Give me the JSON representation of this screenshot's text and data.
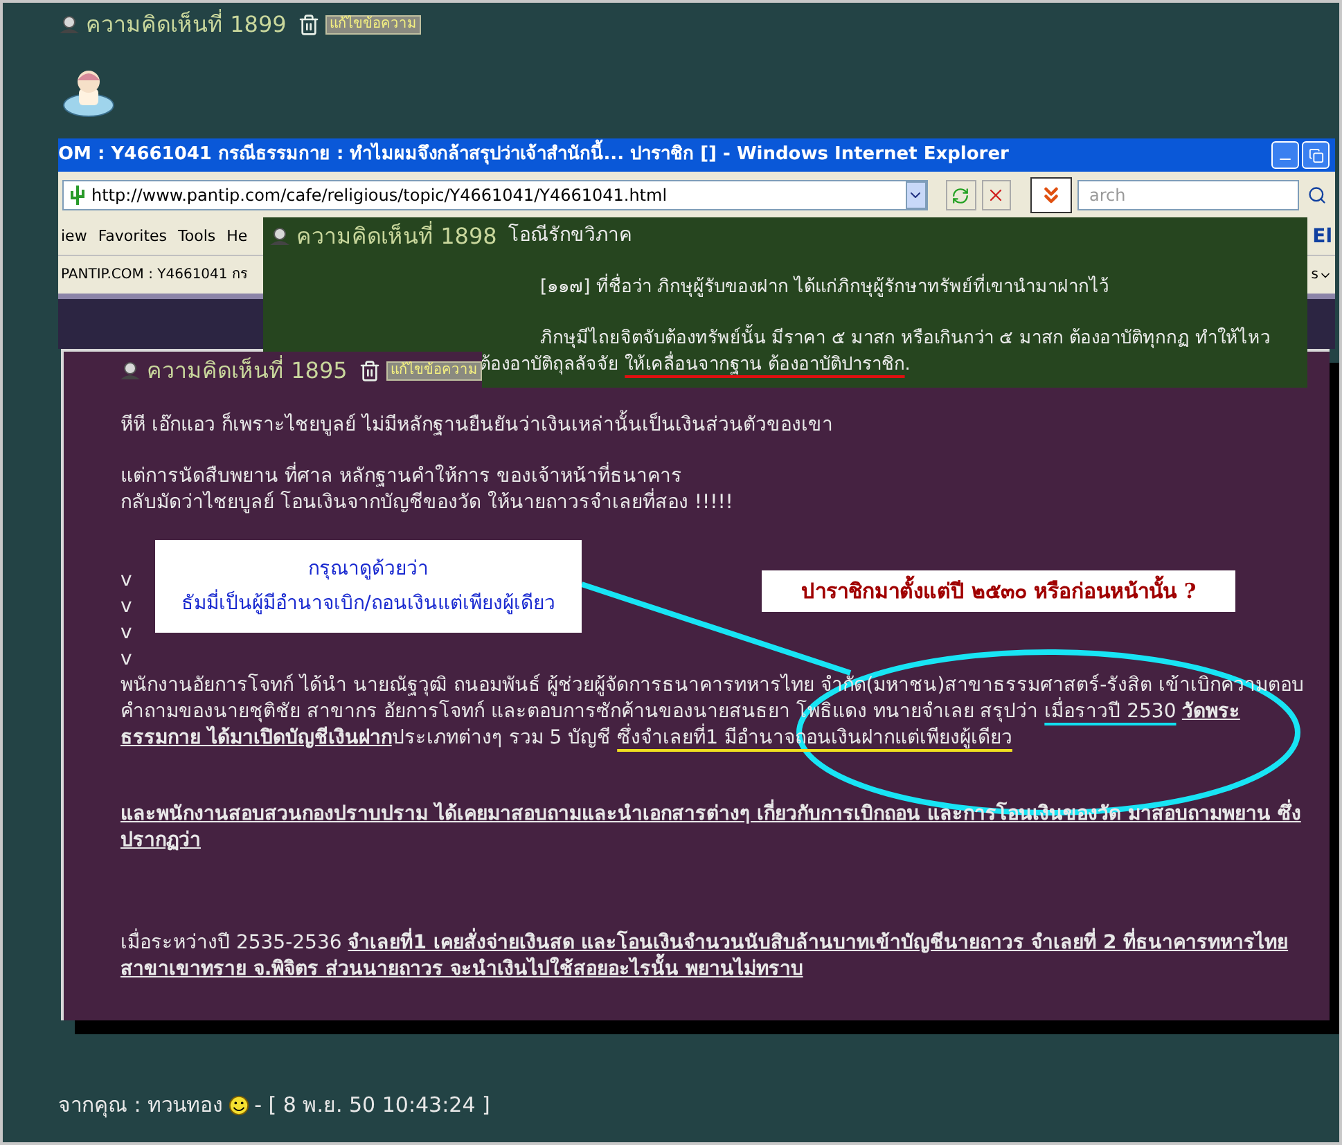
{
  "comment_header": {
    "label": "ความคิดเห็นที่ 1899",
    "edit": "แก้ไขข้อความ"
  },
  "browser_window": {
    "title": "OM : Y4661041 กรณีธรรมกาย : ทำไมผมจึงกล้าสรุปว่าเจ้าสำนักนี้... ปาราชิก [] - Windows Internet Explorer",
    "address": "http://www.pantip.com/cafe/religious/topic/Y4661041/Y4661041.html",
    "search_placeholder": "arch",
    "menu": [
      "iew",
      "Favorites",
      "Tools",
      "He"
    ],
    "menu_right": "El",
    "tab": "PANTIP.COM : Y4661041 กร",
    "tab_right": "s"
  },
  "quoted_comment": {
    "label": "ความคิดเห็นที่ 1898",
    "author": "โอณีรักขวิภาค",
    "paragraphs": [
      [
        {
          "text": "[๑๑๗] ที่ชื่อว่า ภิกษุผู้รับของฝาก ได้แก่ภิกษุผู้รักษาทรัพย์ที่เขานำมาฝากไว้",
          "kind": "plain"
        }
      ],
      [
        {
          "text": "ภิกษุมีไถยจิตจับต้องทรัพย์นั้น มีราคา ๕ มาสก หรือเกินกว่า ๕ มาสก ต้องอาบัติทุกกฏ ทำให้ไหว ต้องอาบัติถุลลัจจัย ",
          "kind": "plain"
        },
        {
          "text": "ให้เคลื่อนจากฐาน ต้องอาบัติปาราชิก",
          "kind": "red-underline"
        },
        {
          "text": ".",
          "kind": "plain"
        }
      ]
    ]
  },
  "comment": {
    "label": "ความคิดเห็นที่ 1895",
    "edit": "แก้ไขข้อความ",
    "paragraphs": [
      [
        [
          {
            "text": "หีหี   เอ๊กแอว   ก็เพราะไชยบูลย์ ไม่มีหลักฐานยืนยันว่าเงินเหล่านั้นเป็นเงินส่วนตัวของเขา",
            "kind": "plain"
          }
        ]
      ],
      [
        [
          {
            "text": "แต่การนัดสืบพยาน ที่ศาล  หลักฐานคำให้การ ของเจ้าหน้าที่ธนาคาร",
            "kind": "plain"
          }
        ],
        [
          {
            "text": "กลับมัดว่าไชยบูลย์ โอนเงินจากบัญชีของวัด  ให้นายถาวรจำเลยที่สอง  !!!!!",
            "kind": "plain"
          }
        ]
      ],
      [
        [
          {
            "text": "v",
            "kind": "plain"
          }
        ],
        [
          {
            "text": "v",
            "kind": "plain"
          }
        ],
        [
          {
            "text": "v",
            "kind": "plain"
          }
        ],
        [
          {
            "text": "v",
            "kind": "plain"
          }
        ]
      ],
      [
        [
          {
            "text": "พนักงานอัยการโจทก์ ได้นำ นายณัฐวุฒิ ถนอมพันธ์ ผู้ช่วยผู้จัดการธนาคารทหารไทย จำกัด(มหาชน)สาขาธรรมศาสตร์-รังสิต เข้าเบิกความตอบคำถามของนายชุติชัย สาขากร อัยการโจทก์ และตอบการซักค้านของนายสนธยา โพธิแดง ทนายจำเลย สรุปว่า ",
            "kind": "plain"
          },
          {
            "text": "เมื่อราวปี 2530",
            "kind": "cyan-underline"
          },
          {
            "text": "วัดพระธรรมกาย ได้มาเปิดบัญชีเงินฝาก",
            "kind": "bold-underline"
          },
          {
            "text": "ประเภทต่างๆ รวม 5 บัญชี ",
            "kind": "plain"
          },
          {
            "text": "ซึ่งจำเลยที่1 มีอำนาจถอนเงินฝากแต่เพียงผู้เดียว",
            "kind": "yellow-underline"
          }
        ]
      ],
      [
        [
          {
            "text": "และพนักงานสอบสวนกองปราบปราม ได้เคยมาสอบถามและนำเอกสารต่างๆ เกี่ยวกับการเบิกถอน และการโอนเงินของวัด มาสอบถามพยาน ซึ่งปรากฏว่า",
            "kind": "bold-underline"
          }
        ]
      ],
      [
        [
          {
            "text": "เมื่อระหว่างปี 2535-2536 ",
            "kind": "plain"
          },
          {
            "text": "จำเลยที่1 เคยสั่งจ่ายเงินสด และโอนเงินจำนวนนับสิบล้านบาทเข้าบัญชีนายถาวร จำเลยที่ 2 ที่ธนาคารทหารไทย สาขาเขาทราย จ.พิจิตร ส่วนนายถาวร จะนำเงินไปใช้สอยอะไรนั้น พยานไม่ทราบ",
            "kind": "bold-underline"
          }
        ]
      ]
    ]
  },
  "callouts": [
    {
      "kind": "note",
      "lines": [
        "กรุณาดูด้วยว่า",
        "ธัมมี่เป็นผู้มีอำนาจเบิก/ถอนเงินแต่เพียงผู้เดียว"
      ]
    },
    {
      "kind": "question",
      "lines": [
        "ปาราชิกมาตั้งแต่ปี ๒๕๓๐ หรือก่อนหน้านั้น ?"
      ]
    }
  ],
  "footer": {
    "author": "จากคุณ : ทวนทอง",
    "timestamp": "- [ 8 พ.ย. 50 10:43:24 ]"
  }
}
